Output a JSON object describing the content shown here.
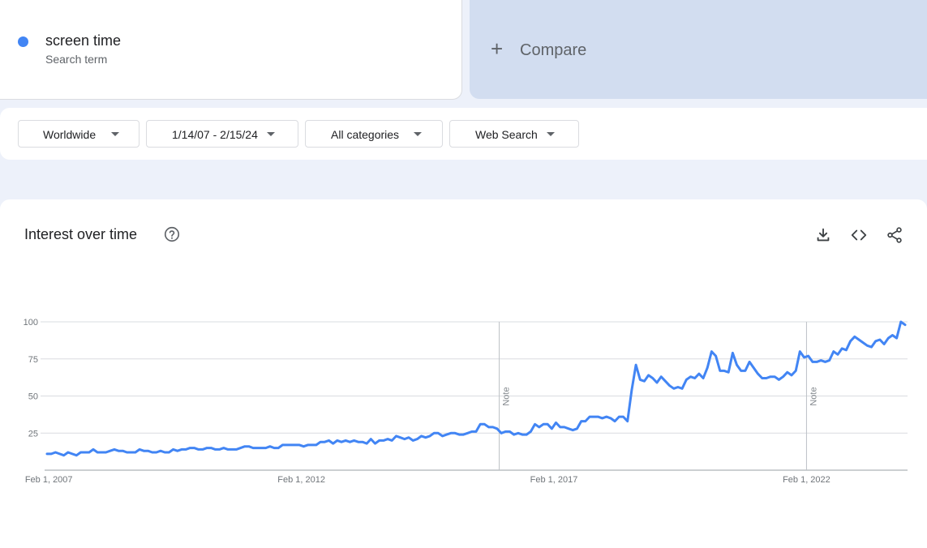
{
  "search_term": {
    "name": "screen time",
    "subtitle": "Search term",
    "color": "#4285f4"
  },
  "compare": {
    "icon": "plus-icon",
    "label": "Compare"
  },
  "filters": [
    {
      "label": "Worldwide"
    },
    {
      "label": "1/14/07 - 2/15/24"
    },
    {
      "label": "All categories"
    },
    {
      "label": "Web Search"
    }
  ],
  "chart_panel": {
    "title": "Interest over time",
    "help_icon": "help-circle-icon",
    "tools": [
      "download-icon",
      "embed-code-icon",
      "share-icon"
    ]
  },
  "chart_data": {
    "type": "line",
    "x_start": "2007-01",
    "x_end": "2024-02",
    "x_ticks": [
      {
        "label": "Feb 1, 2007",
        "date": "2007-02"
      },
      {
        "label": "Feb 1, 2012",
        "date": "2012-02"
      },
      {
        "label": "Feb 1, 2017",
        "date": "2017-02"
      },
      {
        "label": "Feb 1, 2022",
        "date": "2022-02"
      }
    ],
    "y_ticks": [
      25,
      50,
      75,
      100
    ],
    "ylim": [
      0,
      100
    ],
    "grid": true,
    "line_color": "#4285f4",
    "notes": [
      {
        "label": "Note",
        "date": "2016-01"
      },
      {
        "label": "Note",
        "date": "2022-02"
      }
    ],
    "series": [
      {
        "values": [
          11,
          11,
          12,
          11,
          10,
          12,
          11,
          10,
          12,
          12,
          12,
          14,
          12,
          12,
          12,
          13,
          14,
          13,
          13,
          12,
          12,
          12,
          14,
          13,
          13,
          12,
          12,
          13,
          12,
          12,
          14,
          13,
          14,
          14,
          15,
          15,
          14,
          14,
          15,
          15,
          14,
          14,
          15,
          14,
          14,
          14,
          15,
          16,
          16,
          15,
          15,
          15,
          15,
          16,
          15,
          15,
          17,
          17,
          17,
          17,
          17,
          16,
          17,
          17,
          17,
          19,
          19,
          20,
          18,
          20,
          19,
          20,
          19,
          20,
          19,
          19,
          18,
          21,
          18,
          20,
          20,
          21,
          20,
          23,
          22,
          21,
          22,
          20,
          21,
          23,
          22,
          23,
          25,
          25,
          23,
          24,
          25,
          25,
          24,
          24,
          25,
          26,
          26,
          31,
          31,
          29,
          29,
          28,
          25,
          26,
          26,
          24,
          25,
          24,
          24,
          26,
          31,
          29,
          31,
          31,
          28,
          32,
          29,
          29,
          28,
          27,
          28,
          33,
          33,
          36,
          36,
          36,
          35,
          36,
          35,
          33,
          36,
          36,
          33,
          54,
          71,
          61,
          60,
          64,
          62,
          59,
          63,
          60,
          57,
          55,
          56,
          55,
          61,
          63,
          62,
          65,
          62,
          69,
          80,
          77,
          67,
          67,
          66,
          79,
          71,
          67,
          67,
          73,
          69,
          65,
          62,
          62,
          63,
          63,
          61,
          63,
          66,
          64,
          67,
          80,
          76,
          77,
          73,
          73,
          74,
          73,
          74,
          80,
          78,
          82,
          81,
          87,
          90,
          88,
          86,
          84,
          83,
          87,
          88,
          85,
          89,
          91,
          89,
          100,
          98
        ]
      }
    ]
  }
}
